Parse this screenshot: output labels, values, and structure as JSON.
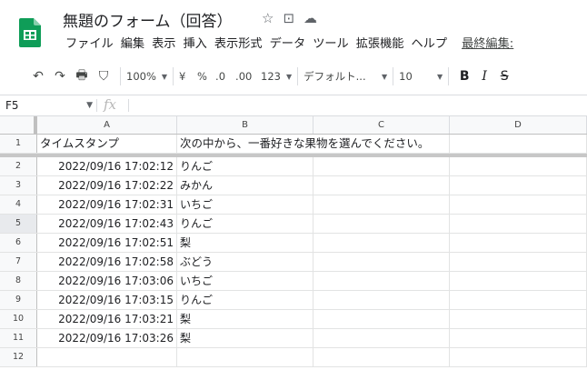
{
  "app": {
    "title": "無題のフォーム（回答）",
    "colors": {
      "brand_green": "#0f9d58",
      "accent": "#1a73e8"
    }
  },
  "menu": [
    "ファイル",
    "編集",
    "表示",
    "挿入",
    "表示形式",
    "データ",
    "ツール",
    "拡張機能",
    "ヘルプ"
  ],
  "last_edit": "最終編集:",
  "toolbar": {
    "icons": [
      "undo-icon",
      "redo-icon",
      "print-icon",
      "paint-format-icon"
    ],
    "zoom": "100%",
    "currency": "¥",
    "percent": "%",
    "dec_decrease": ".0",
    "dec_increase": ".00",
    "more_formats": "123",
    "font": "デフォルト...",
    "font_size": "10",
    "bold": "B",
    "italic": "I",
    "strike": "S"
  },
  "formula_bar": {
    "cell_ref": "F5",
    "fx": "fx",
    "value": ""
  },
  "columns": [
    "A",
    "B",
    "C",
    "D"
  ],
  "header_row": {
    "row": "1",
    "a": "タイムスタンプ",
    "b": "次の中から、一番好きな果物を選んでください。"
  },
  "rows": [
    {
      "row": "2",
      "a": "2022/09/16 17:02:12",
      "b": "りんご"
    },
    {
      "row": "3",
      "a": "2022/09/16 17:02:22",
      "b": "みかん"
    },
    {
      "row": "4",
      "a": "2022/09/16 17:02:31",
      "b": "いちご"
    },
    {
      "row": "5",
      "a": "2022/09/16 17:02:43",
      "b": "りんご"
    },
    {
      "row": "6",
      "a": "2022/09/16 17:02:51",
      "b": "梨"
    },
    {
      "row": "7",
      "a": "2022/09/16 17:02:58",
      "b": "ぶどう"
    },
    {
      "row": "8",
      "a": "2022/09/16 17:03:06",
      "b": "いちご"
    },
    {
      "row": "9",
      "a": "2022/09/16 17:03:15",
      "b": "りんご"
    },
    {
      "row": "10",
      "a": "2022/09/16 17:03:21",
      "b": "梨"
    },
    {
      "row": "11",
      "a": "2022/09/16 17:03:26",
      "b": "梨"
    },
    {
      "row": "12",
      "a": "",
      "b": ""
    }
  ]
}
